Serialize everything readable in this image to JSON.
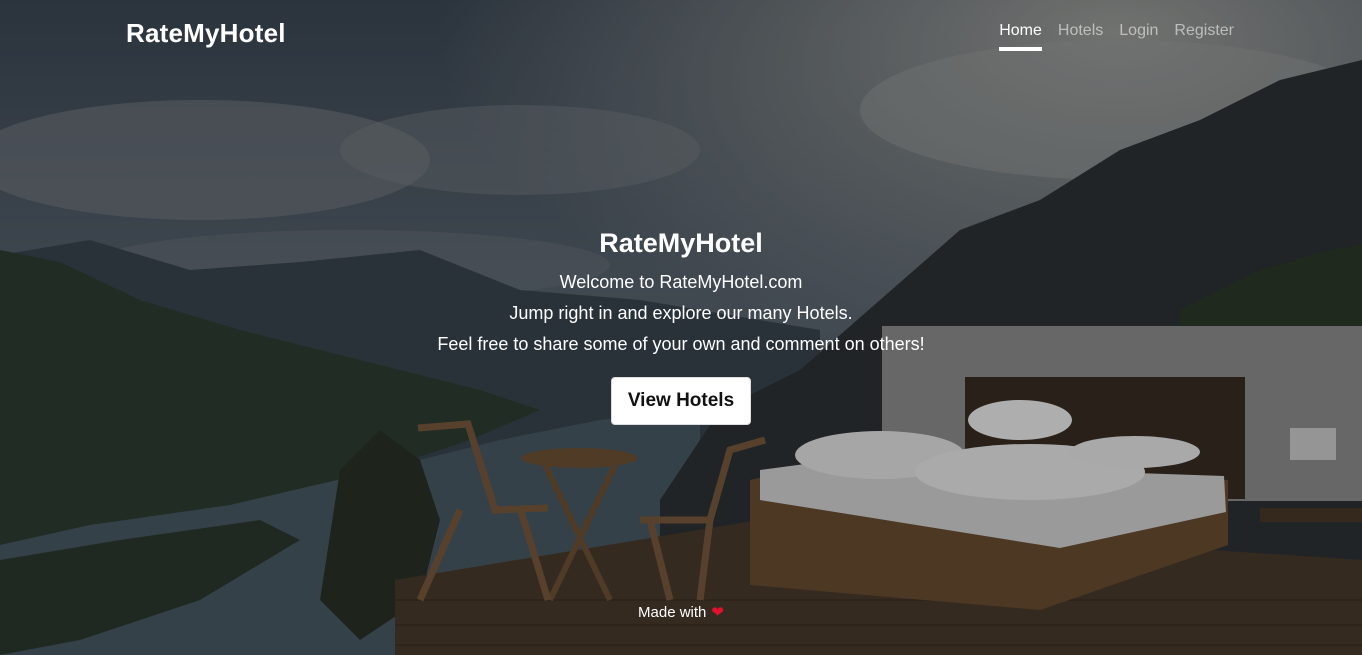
{
  "brand": "RateMyHotel",
  "nav": {
    "home": "Home",
    "hotels": "Hotels",
    "login": "Login",
    "register": "Register"
  },
  "hero": {
    "title": "RateMyHotel",
    "line1": "Welcome to RateMyHotel.com",
    "line2": "Jump right in and explore our many Hotels.",
    "line3": "Feel free to share some of your own and comment on others!",
    "button": "View Hotels"
  },
  "footer": {
    "text": "Made with",
    "heart": "❤"
  },
  "colors": {
    "nav_active": "#ffffff",
    "nav_inactive": "rgba(255,255,255,0.55)",
    "button_bg": "#ffffff",
    "heart": "#e4112c"
  }
}
